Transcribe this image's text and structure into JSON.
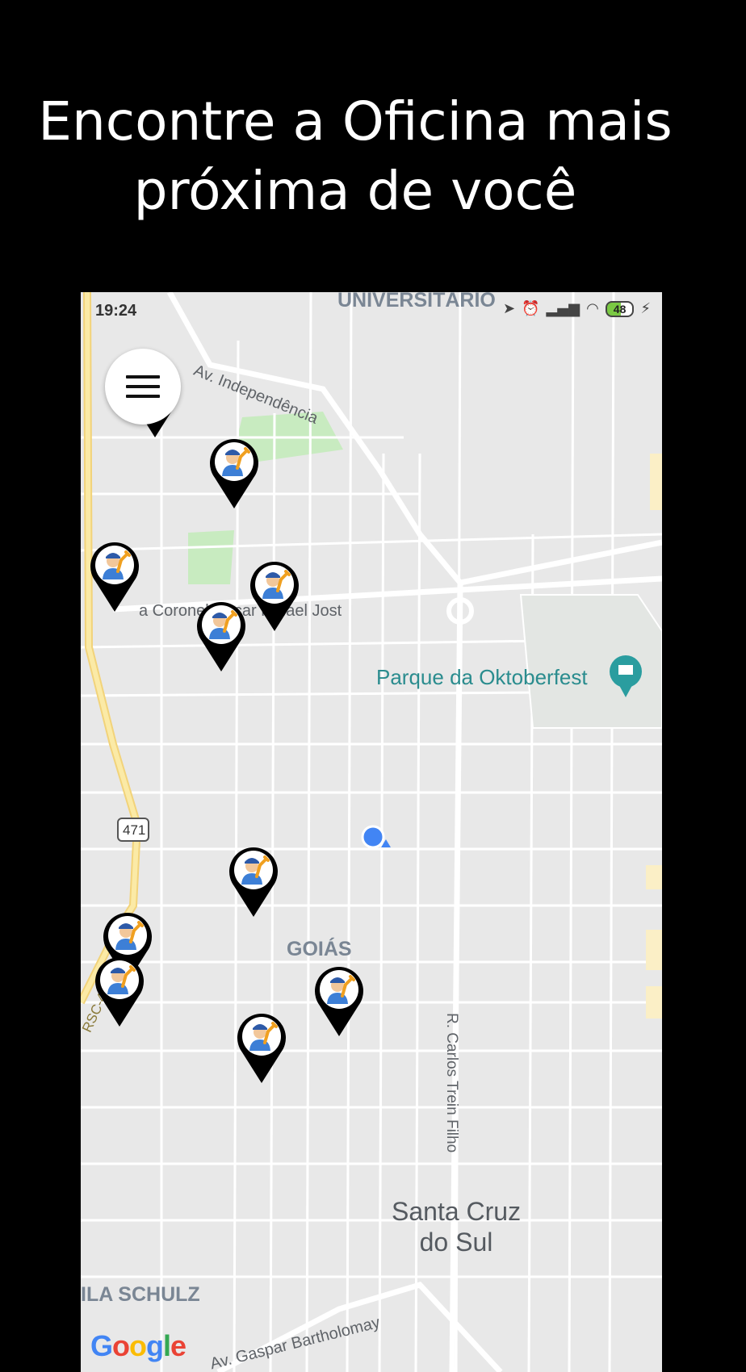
{
  "headline": {
    "line1": "Encontre a Oficina mais",
    "line2": "próxima de você"
  },
  "status_bar": {
    "time": "19:24",
    "battery": "48",
    "icons": [
      "location-arrow-icon",
      "alarm-icon",
      "signal-icon",
      "wifi-icon",
      "battery-icon",
      "charging-icon"
    ]
  },
  "menu_button": {
    "icon": "hamburger-menu-icon"
  },
  "map": {
    "labels": {
      "universitario": "UNIVERSITÁRIO",
      "av_independencia": "Av. Independência",
      "coronel": "a Coronel Oscar Rafael Jost",
      "parque": "Parque da Oktoberfest",
      "route": "471",
      "goias": "GOIÁS",
      "rsc": "RSC-471",
      "carlos_trein": "R. Carlos Trein Filho",
      "santa_cruz_1": "Santa Cruz",
      "santa_cruz_2": "do Sul",
      "vila_schulz": "ILA SCHULZ",
      "gaspar": "Av. Gaspar Bartholomay"
    },
    "colors": {
      "background": "#e8e8e8",
      "roads": "#ffffff",
      "highway": "#f7e6a0",
      "park": "#c8ebc0",
      "poi_teal": "#2a9d9f",
      "user_dot": "#4285F4"
    },
    "google_logo": "Google",
    "markers_count": 10
  }
}
